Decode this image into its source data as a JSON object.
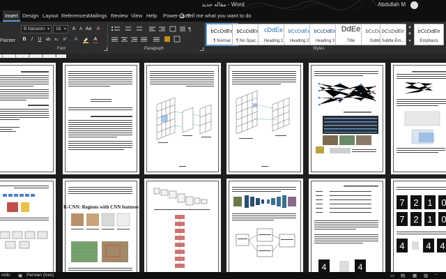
{
  "window": {
    "title": "مقاله جدید  -  Word",
    "user_name": "Abdullah M"
  },
  "tabs": [
    {
      "label": "Insert"
    },
    {
      "label": "Design"
    },
    {
      "label": "Layout"
    },
    {
      "label": "References"
    },
    {
      "label": "Mailings"
    },
    {
      "label": "Review"
    },
    {
      "label": "View"
    },
    {
      "label": "Help"
    },
    {
      "label": "Power-user"
    }
  ],
  "tell_me": {
    "label": "Tell me what you want to do"
  },
  "ribbon": {
    "painter_label": "Painter",
    "font_name": "B Nazanin",
    "font_size": "16",
    "bold": "B",
    "italic": "I",
    "underline": "U",
    "groups": {
      "font": "Font",
      "paragraph": "Paragraph",
      "styles": "Styles"
    },
    "styles": [
      {
        "sample": "bCcDdEe",
        "name": "¶ Normal"
      },
      {
        "sample": "bCcDdEe",
        "name": "¶ No Spac..."
      },
      {
        "sample": "cDdEe",
        "name": "Heading 1"
      },
      {
        "sample": "bCcDdEe",
        "name": "Heading 2"
      },
      {
        "sample": "bCcDdEe",
        "name": "Heading 3"
      },
      {
        "sample": "DdEe",
        "name": "Title"
      },
      {
        "sample": "bCcDdEe",
        "name": "Subtitle"
      },
      {
        "sample": "bCcDdEe",
        "name": "Subtle Em..."
      },
      {
        "sample": "bCcDdEe",
        "name": "Emphasis"
      }
    ],
    "colors": {
      "highlight": "#f3e14b",
      "font_color": "#e03c31"
    }
  },
  "status": {
    "words": "ords",
    "language": "Persian (Iran)"
  },
  "document": {
    "page_count_visible": 12
  }
}
